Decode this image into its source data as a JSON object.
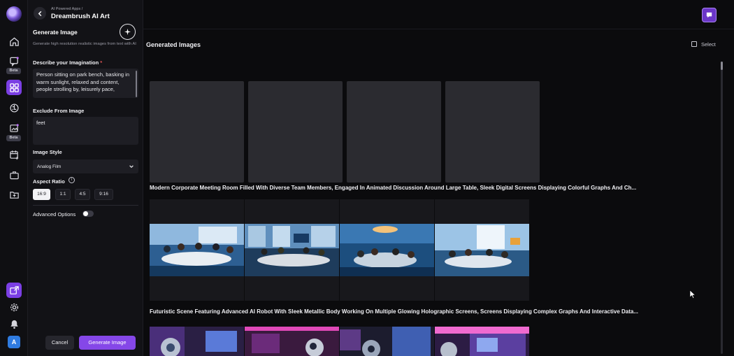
{
  "rail": {
    "items": [
      {
        "icon": "home-icon"
      },
      {
        "icon": "chat-icon",
        "badge": "Beta"
      },
      {
        "icon": "apps-grid-icon",
        "active": true
      },
      {
        "icon": "brain-icon"
      },
      {
        "icon": "edit-image-icon",
        "badge": "Beta"
      },
      {
        "icon": "calendar-add-icon"
      },
      {
        "icon": "briefcase-icon"
      },
      {
        "icon": "folder-icon"
      }
    ],
    "bottom": [
      {
        "icon": "promo-icon"
      },
      {
        "icon": "settings-icon"
      },
      {
        "icon": "bell-icon"
      }
    ],
    "avatar_letter": "A"
  },
  "panel": {
    "breadcrumb": "AI Powered Apps /",
    "app_title": "Dreambrush AI Art",
    "section_title": "Generate Image",
    "subtitle": "Generate high resolution realistic images from text with AI",
    "describe_label": "Describe your Imagination",
    "required_mark": "*",
    "describe_value": "Person sitting on park bench, basking in warm sunlight, relaxed and content, people strolling by, leisurely pace,",
    "exclude_label": "Exclude From Image",
    "exclude_value": "feet",
    "style_label": "Image Style",
    "style_value": "Analog Film",
    "ratio_label": "Aspect Ratio",
    "info_glyph": "i",
    "ratios": [
      "16:9",
      "1:1",
      "4:5",
      "9:16"
    ],
    "selected_ratio": "16:9",
    "advanced_label": "Advanced Options",
    "advanced_enabled": false,
    "cancel_label": "Cancel",
    "generate_label": "Generate Image"
  },
  "main": {
    "section_title": "Generated Images",
    "select_label": "Select",
    "groups": [
      {
        "prompt": "Modern Corporate Meeting Room Filled With Diverse Team Members, Engaged In Animated Discussion Around Large Table, Sleek Digital Screens Displaying Colorful Graphs And Ch...",
        "status": "loading",
        "count": 4
      },
      {
        "prompt": "Futuristic Scene Featuring Advanced AI Robot With Sleek Metallic Body Working On Multiple Glowing Holographic Screens, Screens Displaying Complex Graphs And Interactive Data...",
        "status": "done",
        "count": 4
      },
      {
        "status": "done",
        "count": 4
      }
    ],
    "colors": {
      "accent": "#8547e8",
      "panel_bg": "#121216",
      "main_bg": "#0b0b0d",
      "placeholder": "#2b2b30"
    }
  }
}
